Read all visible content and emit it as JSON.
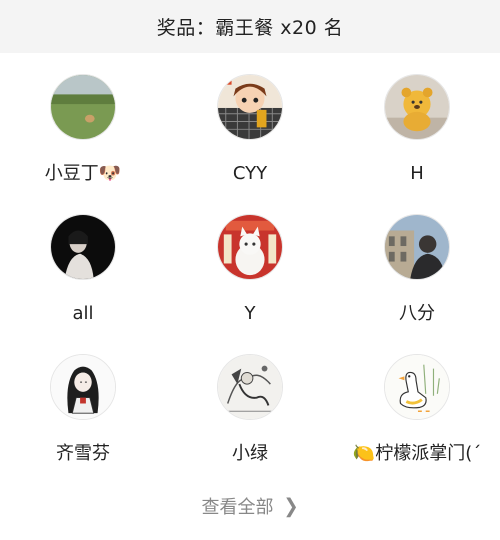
{
  "header": {
    "title": "奖品：霸王餐 x20 名"
  },
  "winners": [
    {
      "name": "小豆丁🐶",
      "avatar": "avatar-grass-dog"
    },
    {
      "name": "CYY",
      "avatar": "avatar-cartoon-kid"
    },
    {
      "name": "H",
      "avatar": "avatar-yellow-bear"
    },
    {
      "name": "all",
      "avatar": "avatar-dark-portrait"
    },
    {
      "name": "Y",
      "avatar": "avatar-white-cat"
    },
    {
      "name": "八分",
      "avatar": "avatar-man-building"
    },
    {
      "name": "齐雪芬",
      "avatar": "avatar-anime-girl"
    },
    {
      "name": "小绿",
      "avatar": "avatar-ink-sketch"
    },
    {
      "name": "🍋柠檬派掌门(´",
      "avatar": "avatar-goose-doodle"
    }
  ],
  "footer": {
    "view_all_label": "查看全部",
    "icon": "chevron-right-icon"
  }
}
